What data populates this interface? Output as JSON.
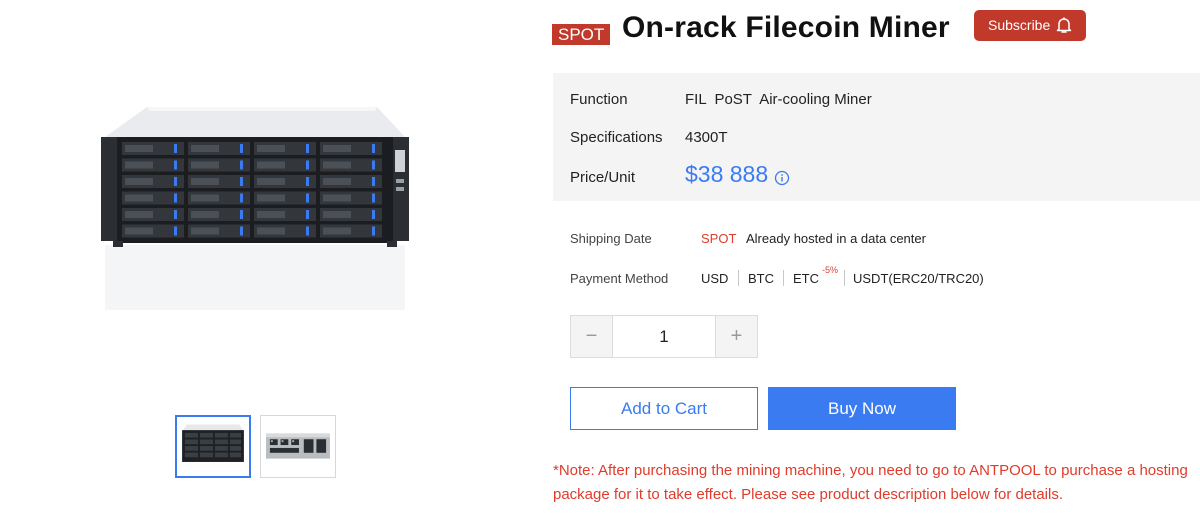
{
  "title": {
    "badge": "SPOT",
    "name": "On-rack Filecoin Miner",
    "subscribe_label": "Subscribe"
  },
  "specs": {
    "function_label": "Function",
    "function_value": "FIL  PoST  Air-cooling Miner",
    "specifications_label": "Specifications",
    "specifications_value": "4300T",
    "price_label": "Price/Unit",
    "price_value": "$38 888"
  },
  "shipping": {
    "label": "Shipping Date",
    "tag": "SPOT",
    "text": "Already hosted in a data center"
  },
  "payment": {
    "label": "Payment Method",
    "methods": [
      "USD",
      "BTC",
      "ETC",
      "USDT(ERC20/TRC20)"
    ],
    "etc_discount": "-5%"
  },
  "quantity": {
    "minus_label": "−",
    "plus_label": "+",
    "value": "1"
  },
  "actions": {
    "add_to_cart": "Add to Cart",
    "buy_now": "Buy Now"
  },
  "note": "*Note: After purchasing the mining machine, you need to go to ANTPOOL to purchase a hosting package for it to take effect. Please see product description below for details.",
  "colors": {
    "accent_blue": "#3b7bf2",
    "brand_red": "#c0392b",
    "note_red": "#e03b2b",
    "spec_bg": "#f4f4f4"
  },
  "icons": {
    "subscribe": "bell-icon",
    "price_info": "info-circle-icon",
    "gallery": "server-rack-image"
  }
}
